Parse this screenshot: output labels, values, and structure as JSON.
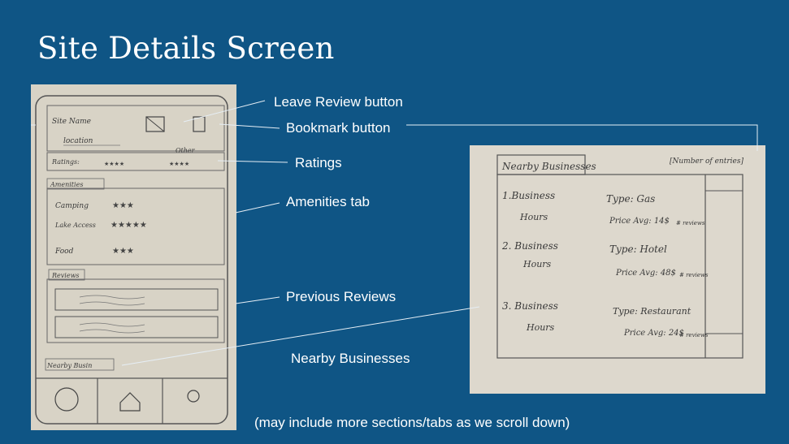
{
  "slide": {
    "title": "Site Details Screen",
    "footer_note": "(may include more sections/tabs as we scroll down)"
  },
  "callouts": {
    "leave_review": "Leave Review button",
    "bookmark": "Bookmark button",
    "ratings": "Ratings",
    "amenities": "Amenities tab",
    "previous_reviews": "Previous Reviews",
    "nearby_businesses": "Nearby Businesses"
  },
  "sketch_main": {
    "site_name": "Site Name",
    "location": "location",
    "other": "Other",
    "ratings_label": "Ratings:",
    "amenities_tab": "Amenities",
    "amenity_items": [
      "Camping",
      "Lake Access",
      "Food"
    ],
    "reviews_tab": "Reviews",
    "nearby_tab": "Nearby Busin"
  },
  "sketch_nearby": {
    "tab_label": "Nearby Businesses",
    "entries_count": "[Number of entries]",
    "businesses": [
      {
        "name": "1.Business",
        "hours": "Hours",
        "type": "Type: Gas",
        "price": "Price Avg: 14$",
        "reviews": "# reviews"
      },
      {
        "name": "2. Business",
        "hours": "Hours",
        "type": "Type: Hotel",
        "price": "Price Avg: 48$",
        "reviews": "# reviews"
      },
      {
        "name": "3. Business",
        "hours": "Hours",
        "type": "Type: Restaurant",
        "price": "Price Avg: 24$",
        "reviews": "# reviews"
      }
    ]
  },
  "colors": {
    "background": "#0f5585",
    "text": "#ffffff",
    "paper": "#d9d4c8"
  }
}
